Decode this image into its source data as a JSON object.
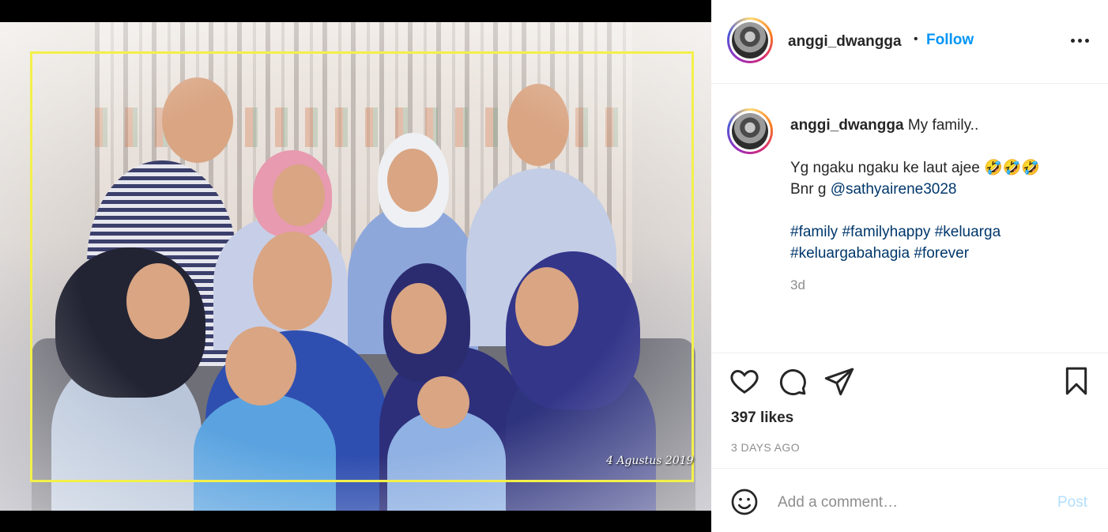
{
  "post": {
    "username": "anggi_dwangga",
    "follow_label": "Follow",
    "separator": "•",
    "photo_date_text": "4 Agustus 2019"
  },
  "caption": {
    "username": "anggi_dwangga",
    "line1": "My family..",
    "line2_text": "Yg ngaku ngaku ke laut ajee",
    "line2_emoji": "🤣🤣🤣",
    "line3_prefix": "Bnr g",
    "mention": "@sathyairene3028",
    "hashtags_line1": "#family #familyhappy #keluarga",
    "hashtags_line2": "#keluargabahagia #forever",
    "relative_time": "3d"
  },
  "stats": {
    "likes": "397 likes",
    "date": "3 DAYS AGO"
  },
  "comment": {
    "placeholder": "Add a comment…",
    "post_label": "Post"
  },
  "icons": {
    "like": "heart-icon",
    "comment": "speech-bubble-icon",
    "share": "paper-plane-icon",
    "save": "bookmark-icon",
    "emoji": "smiley-icon",
    "more": "more-horizontal-icon"
  },
  "colors": {
    "accent": "#0095f6",
    "frame": "#f3f04a",
    "post_disabled": "#b2dffc"
  }
}
